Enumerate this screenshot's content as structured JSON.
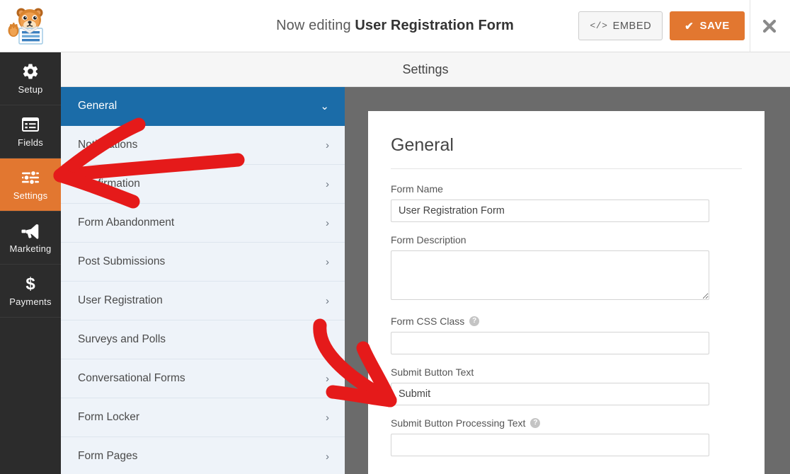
{
  "header": {
    "logo_alt": "wpforms-bear-logo",
    "now_editing_prefix": "Now editing ",
    "form_title": "User Registration Form",
    "embed_label": "EMBED",
    "embed_icon_text": "</>",
    "save_label": "SAVE",
    "save_check": "✔",
    "close_label": "✖",
    "accent_orange": "#e27730",
    "accent_blue": "#1b6ca8"
  },
  "sidebar": {
    "items": [
      {
        "label": "Setup",
        "icon": "gear-icon",
        "active": false
      },
      {
        "label": "Fields",
        "icon": "fields-list-icon",
        "active": false
      },
      {
        "label": "Settings",
        "icon": "sliders-icon",
        "active": true
      },
      {
        "label": "Marketing",
        "icon": "megaphone-icon",
        "active": false
      },
      {
        "label": "Payments",
        "icon": "dollar-icon",
        "active": false
      }
    ]
  },
  "subheader": {
    "title": "Settings"
  },
  "settings_menu": {
    "items": [
      {
        "label": "General",
        "active": true,
        "chevron": "⌄"
      },
      {
        "label": "Notifications",
        "active": false,
        "chevron": "›"
      },
      {
        "label": "Confirmation",
        "active": false,
        "chevron": "›"
      },
      {
        "label": "Form Abandonment",
        "active": false,
        "chevron": "›"
      },
      {
        "label": "Post Submissions",
        "active": false,
        "chevron": "›"
      },
      {
        "label": "User Registration",
        "active": false,
        "chevron": "›"
      },
      {
        "label": "Surveys and Polls",
        "active": false,
        "chevron": ""
      },
      {
        "label": "Conversational Forms",
        "active": false,
        "chevron": "›"
      },
      {
        "label": "Form Locker",
        "active": false,
        "chevron": "›"
      },
      {
        "label": "Form Pages",
        "active": false,
        "chevron": "›"
      }
    ]
  },
  "panel": {
    "title": "General",
    "fields": {
      "form_name": {
        "label": "Form Name",
        "value": "User Registration Form",
        "help": false
      },
      "form_description": {
        "label": "Form Description",
        "value": "",
        "help": false
      },
      "form_css_class": {
        "label": "Form CSS Class",
        "value": "",
        "help": true,
        "help_glyph": "?"
      },
      "submit_button_text": {
        "label": "Submit Button Text",
        "value": "Submit",
        "help": false
      },
      "submit_button_processing_text": {
        "label": "Submit Button Processing Text",
        "value": "",
        "help": true,
        "help_glyph": "?"
      }
    }
  },
  "annotations": {
    "arrow_color": "#e51a1a",
    "arrow_1_points_to": "sidebar-item-settings",
    "arrow_2_points_to": "submit-button-text-input"
  }
}
